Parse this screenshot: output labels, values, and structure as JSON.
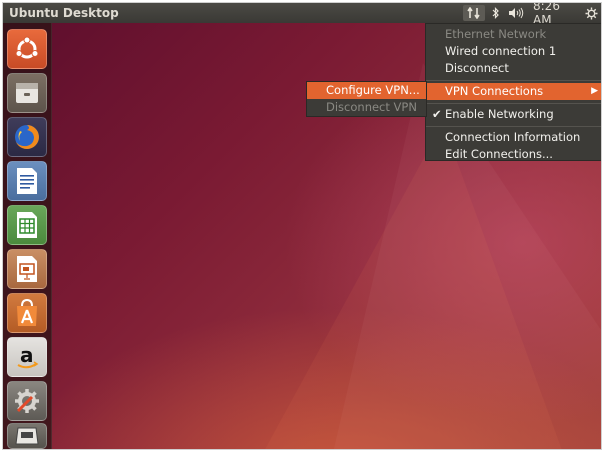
{
  "top_panel": {
    "app_title": "Ubuntu Desktop",
    "clock": "8:26 AM",
    "indicators": [
      "network-icon",
      "bluetooth-icon",
      "volume-icon",
      "session-gear-icon"
    ]
  },
  "launcher": {
    "items": [
      {
        "name": "ubuntu-dash-icon"
      },
      {
        "name": "files-icon"
      },
      {
        "name": "firefox-icon"
      },
      {
        "name": "libreoffice-writer-icon"
      },
      {
        "name": "libreoffice-calc-icon"
      },
      {
        "name": "libreoffice-impress-icon"
      },
      {
        "name": "software-center-icon"
      },
      {
        "name": "amazon-icon"
      },
      {
        "name": "system-settings-icon"
      },
      {
        "name": "trash-icon"
      }
    ]
  },
  "network_menu": {
    "ethernet_header": "Ethernet Network",
    "wired_connection": "Wired connection 1",
    "disconnect": "Disconnect",
    "vpn_connections": "VPN Connections",
    "enable_networking": "Enable Networking",
    "enable_networking_checked": true,
    "connection_information": "Connection Information",
    "edit_connections": "Edit Connections...",
    "accent_color": "#e2642f"
  },
  "vpn_submenu": {
    "configure_vpn": "Configure VPN...",
    "disconnect_vpn": "Disconnect VPN"
  }
}
